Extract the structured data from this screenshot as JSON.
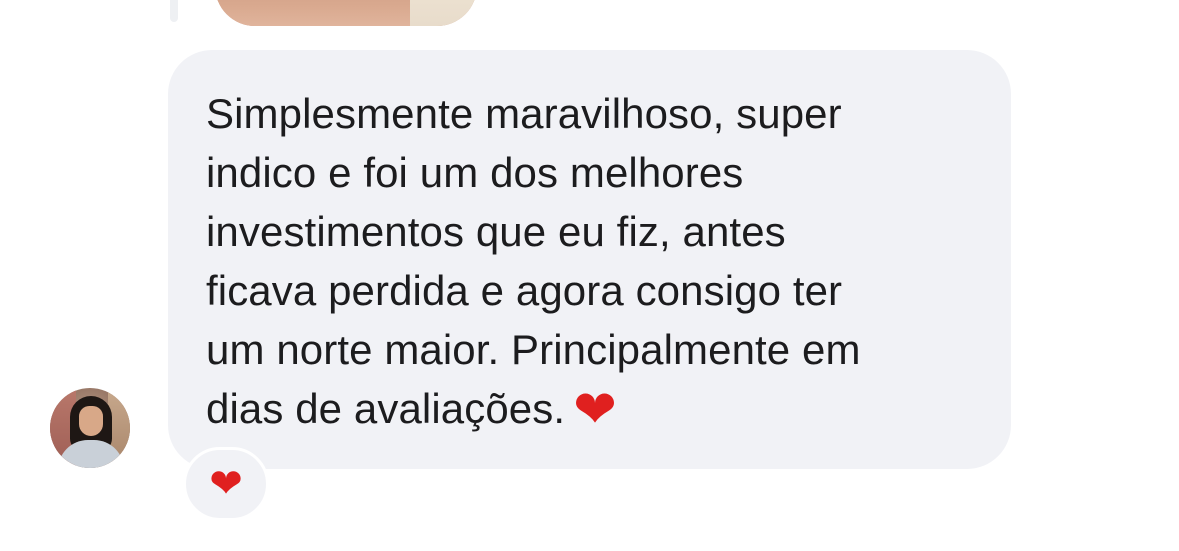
{
  "message": {
    "lines": [
      "Simplesmente maravilhoso, super",
      "indico e foi um dos melhores",
      "investimentos que eu fiz, antes",
      "ficava perdida e agora consigo ter",
      "um norte maior. Principalmente em",
      "dias de avaliações."
    ],
    "inline_emoji": "❤",
    "inline_emoji_name": "red-heart",
    "bubble_color": "#f1f2f6",
    "text_color": "#1c1c1e"
  },
  "reaction": {
    "emoji": "❤",
    "emoji_name": "red-heart"
  },
  "avatar": {
    "icon": "profile-photo"
  },
  "colors": {
    "heart": "#e0201f",
    "background": "#ffffff"
  }
}
